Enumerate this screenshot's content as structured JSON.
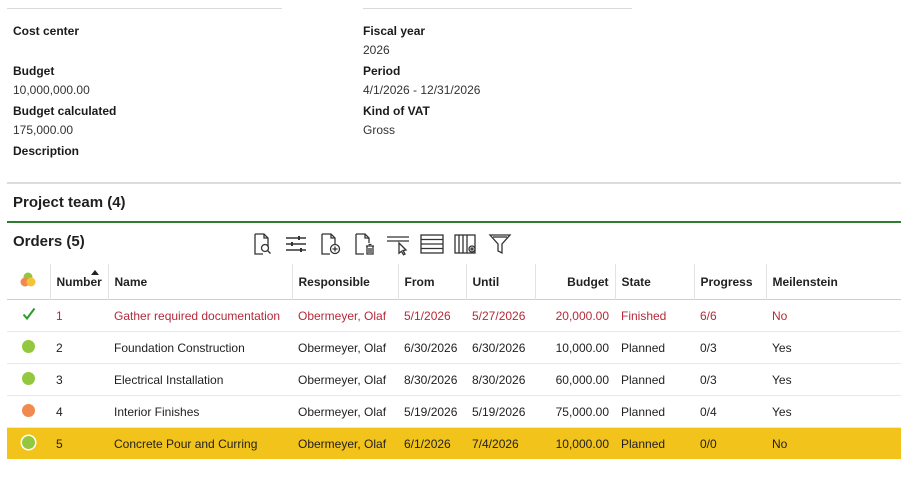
{
  "fields": {
    "cost_center_label": "Cost center",
    "cost_center_value": "",
    "fiscal_year_label": "Fiscal year",
    "fiscal_year_value": "2026",
    "budget_label": "Budget",
    "budget_value": "10,000,000.00",
    "period_label": "Period",
    "period_value": "4/1/2026 - 12/31/2026",
    "budget_calc_label": "Budget calculated",
    "budget_calc_value": "175,000.00",
    "vat_label": "Kind of VAT",
    "vat_value": "Gross",
    "description_label": "Description"
  },
  "team": {
    "title": "Project team (4)"
  },
  "orders": {
    "title": "Orders (5)",
    "toolbar_icons": [
      "document-search-icon",
      "sliders-icon",
      "add-document-icon",
      "delete-document-icon",
      "select-cursor-icon",
      "rows-icon",
      "column-settings-icon",
      "filter-icon"
    ],
    "columns": {
      "number": "Number",
      "name": "Name",
      "responsible": "Responsible",
      "from": "From",
      "until": "Until",
      "budget": "Budget",
      "state": "State",
      "progress": "Progress",
      "milestone": "Meilenstein"
    },
    "rows": [
      {
        "status": "check",
        "number": "1",
        "name": "Gather required documentation",
        "responsible": "Obermeyer, Olaf",
        "from": "5/1/2026",
        "until": "5/27/2026",
        "budget": "20,000.00",
        "state": "Finished",
        "progress": "6/6",
        "milestone": "No"
      },
      {
        "status": "green",
        "number": "2",
        "name": "Foundation Construction",
        "responsible": "Obermeyer, Olaf",
        "from": "6/30/2026",
        "until": "6/30/2026",
        "budget": "10,000.00",
        "state": "Planned",
        "progress": "0/3",
        "milestone": "Yes"
      },
      {
        "status": "green",
        "number": "3",
        "name": "Electrical Installation",
        "responsible": "Obermeyer, Olaf",
        "from": "8/30/2026",
        "until": "8/30/2026",
        "budget": "60,000.00",
        "state": "Planned",
        "progress": "0/3",
        "milestone": "Yes"
      },
      {
        "status": "orange",
        "number": "4",
        "name": "Interior Finishes",
        "responsible": "Obermeyer, Olaf",
        "from": "5/19/2026",
        "until": "5/19/2026",
        "budget": "75,000.00",
        "state": "Planned",
        "progress": "0/4",
        "milestone": "Yes"
      },
      {
        "status": "green",
        "number": "5",
        "name": "Concrete Pour and Curring",
        "responsible": "Obermeyer, Olaf",
        "from": "6/1/2026",
        "until": "7/4/2026",
        "budget": "10,000.00",
        "state": "Planned",
        "progress": "0/0",
        "milestone": "No"
      }
    ],
    "colors": {
      "finished_text": "#b52a3a",
      "selected_row": "#f2c31a",
      "status_green": "#93c83e",
      "status_orange": "#f18a4e",
      "check": "#2e9a2e"
    }
  }
}
